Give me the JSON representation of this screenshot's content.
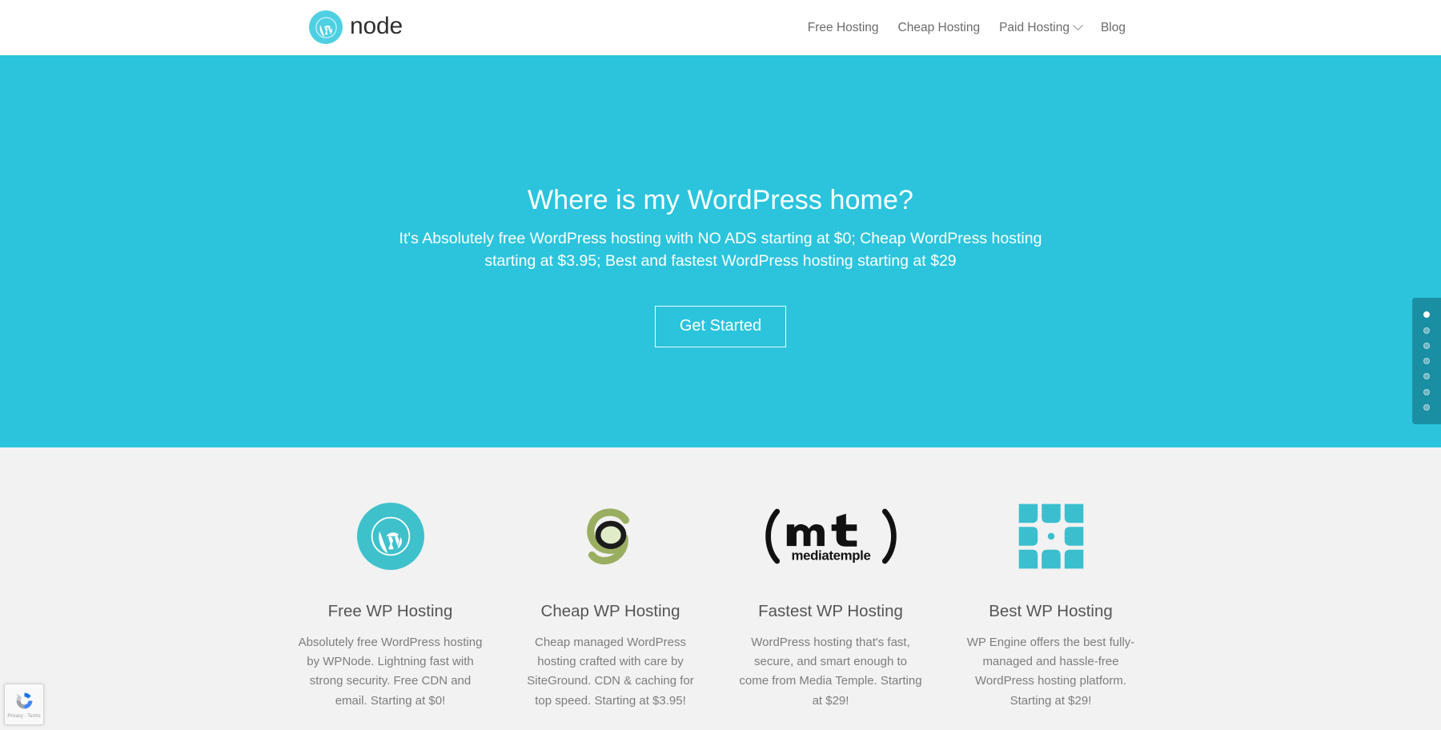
{
  "header": {
    "brand": {
      "mark_icon": "wordpress-icon",
      "text": "node"
    },
    "nav": [
      {
        "label": "Free Hosting",
        "has_dropdown": false
      },
      {
        "label": "Cheap Hosting",
        "has_dropdown": false
      },
      {
        "label": "Paid Hosting",
        "has_dropdown": true
      },
      {
        "label": "Blog",
        "has_dropdown": false
      }
    ]
  },
  "hero": {
    "title": "Where is my WordPress home?",
    "subtitle": "It's Absolutely free WordPress hosting with NO ADS starting at $0; Cheap WordPress hosting starting at $3.95; Best and fastest WordPress hosting starting at $29",
    "cta_label": "Get Started",
    "background_color": "#2bc4dc"
  },
  "dot_nav": {
    "count": 7,
    "active_index": 0,
    "background_color": "#1a8fa3"
  },
  "features": {
    "background_color": "#f2f2f2",
    "items": [
      {
        "logo": "wordpress-circle-logo",
        "title": "Free WP Hosting",
        "description": "Absolutely free WordPress hosting by WPNode. Lightning fast with strong security. Free CDN and email. Starting at $0!"
      },
      {
        "logo": "siteground-logo",
        "title": "Cheap WP Hosting",
        "description": "Cheap managed WordPress hosting crafted with care by SiteGround. CDN & caching for top speed. Starting at $3.95!"
      },
      {
        "logo": "mediatemple-logo",
        "title": "Fastest WP Hosting",
        "description": "WordPress hosting that's fast, secure, and smart enough to come from Media Temple. Starting at $29!"
      },
      {
        "logo": "wpengine-logo",
        "title": "Best WP Hosting",
        "description": "WP Engine offers the best fully-managed and hassle-free WordPress hosting platform. Starting at $29!"
      }
    ]
  },
  "recaptcha": {
    "icon": "recaptcha-icon",
    "legal": "Privacy - Terms"
  }
}
